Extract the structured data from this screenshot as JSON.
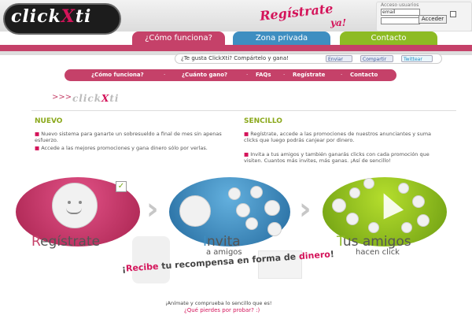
{
  "brand": {
    "logo_text_left": "click",
    "logo_text_x": "X",
    "logo_text_right": "ti",
    "register_now": "Regístrate",
    "register_now2": "ya!"
  },
  "login": {
    "label": "Acceso usuarios",
    "email_value": "email",
    "enter_label": "Acceder"
  },
  "tabs": [
    {
      "label": "¿Cómo funciona?"
    },
    {
      "label": "Zona privada"
    },
    {
      "label": "Contacto"
    }
  ],
  "share": {
    "text": "¿Te gusta ClickXti? Compártelo y gana!",
    "fb_like": "Enviar",
    "fb_share": "Compartir",
    "twitter": "Twittear"
  },
  "nav": [
    {
      "label": "¿Cómo funciona?"
    },
    {
      "label": "¿Cuánto gano?"
    },
    {
      "label": "FAQs"
    },
    {
      "label": "Regístrate"
    },
    {
      "label": "Contacto"
    }
  ],
  "nuevo": {
    "title": "NUEVO",
    "p1": "Nuevo sistema para ganarte un sobresueldo a final de mes sin apenas esfuerzo.",
    "p2": "Accede a las mejores promociones y gana dinero sólo por verlas."
  },
  "sencillo": {
    "title": "SENCILLO",
    "p1": "Regístrate, accede a las promociones de nuestros anunciantes y suma clicks que luego podrás canjear por dinero.",
    "p2": "Invita a tus amigos y también ganarás clicks con cada promoción que visiten. Cuantos más invites, más ganas. ¡Así de sencillo!"
  },
  "steps": [
    {
      "title_first": "R",
      "title_rest": "egístrate",
      "sub": ""
    },
    {
      "title_first": "I",
      "title_rest": "nvita",
      "sub": "a amigos"
    },
    {
      "title_first": "T",
      "title_rest": "us amigos",
      "sub": "hacen click"
    }
  ],
  "banner": {
    "part1": "¡",
    "pink1": "Recibe",
    "mid": " tu recompensa en forma de ",
    "pink2": "dinero",
    "end": "!"
  },
  "footer": {
    "line1": "¡Anímate y comprueba lo sencillo que es!",
    "line2": "¿Qué pierdes por probar? :)"
  },
  "colors": {
    "pink": "#c54169",
    "blue": "#3e8ec1",
    "green": "#8dbb24"
  }
}
